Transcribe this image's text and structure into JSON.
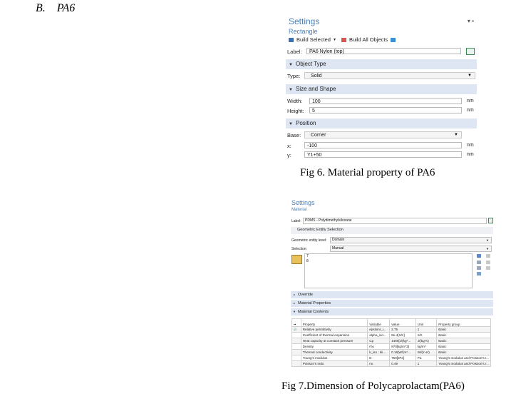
{
  "heading": {
    "letter": "B.",
    "text": "PA6"
  },
  "panel1": {
    "title": "Settings",
    "subtitle": "Rectangle",
    "toolbar": {
      "build_selected": "Build Selected",
      "build_all": "Build All Objects"
    },
    "label": {
      "caption": "Label:",
      "value": "PA6 Nylon (top)"
    },
    "object_type": {
      "header": "Object Type",
      "type_caption": "Type:",
      "type_value": "Solid"
    },
    "size_shape": {
      "header": "Size and Shape",
      "width_caption": "Width:",
      "width_value": "100",
      "height_caption": "Height:",
      "height_value": "5",
      "unit": "nm"
    },
    "position": {
      "header": "Position",
      "base_caption": "Base:",
      "base_value": "Corner",
      "x_caption": "x:",
      "x_value": "-100",
      "y_caption": "y:",
      "y_value": "Y1+50",
      "unit": "nm"
    },
    "caption": "Fig 6. Material property of PA6"
  },
  "panel2": {
    "title": "Settings",
    "subtitle": "Material",
    "label_caption": "Label:",
    "label_value": "PDMS - Polydimethylsiloxane",
    "geom_section": "Geometric Entity Selection",
    "geom_level_caption": "Geometric entity level:",
    "geom_level_value": "Domain",
    "selection_caption": "Selection:",
    "selection_value": "Manual",
    "selection_list": [
      "7",
      "8"
    ],
    "sections": [
      "Override",
      "Material Properties",
      "Material Contents"
    ],
    "table": {
      "headers": [
        "Property",
        "Variable",
        "Value",
        "Unit",
        "Property group"
      ],
      "rows": [
        [
          "Relative permittivity",
          "epsilonr_i...",
          "2.75",
          "1",
          "Basic"
        ],
        [
          "Coefficient of thermal expansion",
          "alpha_iso...",
          "9e-4[1/K]",
          "1/K",
          "Basic"
        ],
        [
          "Heat capacity at constant pressure",
          "Cp",
          "1460[J/(kg*...",
          "J/(kg·K)",
          "Basic"
        ],
        [
          "Density",
          "rho",
          "970[kg/m^3]",
          "kg/m³",
          "Basic"
        ],
        [
          "Thermal conductivity",
          "k_iso ; kii...",
          "0.16[W/(m*...",
          "W/(m·K)",
          "Basic"
        ],
        [
          "Young's modulus",
          "E",
          "750[kPa]",
          "Pa",
          "Young's modulus and Poisson's r..."
        ],
        [
          "Poisson's ratio",
          "nu",
          "0.49",
          "1",
          "Young's modulus and Poisson's r..."
        ]
      ]
    },
    "caption": "Fig 7.Dimension of Polycaprolactam(PA6)"
  }
}
